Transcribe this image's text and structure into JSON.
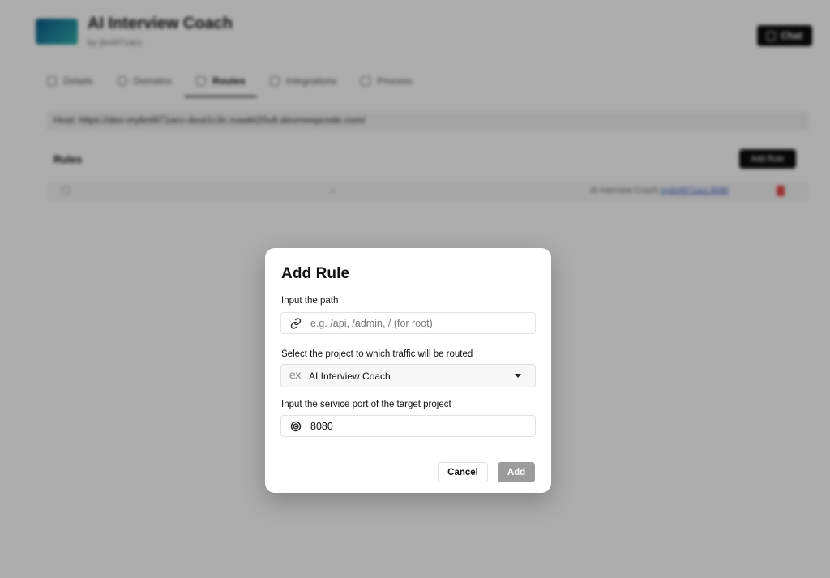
{
  "background": {
    "app_title": "AI Interview Coach",
    "app_subtitle": "by jbnt971acc",
    "chat_button": "Chat",
    "tabs": [
      {
        "label": "Details",
        "icon": "list-icon"
      },
      {
        "label": "Domains",
        "icon": "globe-icon"
      },
      {
        "label": "Routes",
        "icon": "route-icon",
        "active": true
      },
      {
        "label": "Integrations",
        "icon": "grid-icon"
      },
      {
        "label": "Process",
        "icon": "terminal-icon"
      }
    ],
    "host": "Host: https://dev-mybnt971acc-dvut1c3c.ruaakt20ufi.devmeepcode.com/",
    "rules_title": "Rules",
    "add_rule_button": "Add Rule",
    "rule_row": {
      "arrow": "→",
      "destination": "AI Interview Coach",
      "destination_link": "mybnt971acc:8080"
    }
  },
  "modal": {
    "title": "Add Rule",
    "path": {
      "label": "Input the path",
      "placeholder": "e.g. /api, /admin, / (for root)",
      "value": "",
      "icon": "link-icon"
    },
    "project": {
      "label": "Select the project to which traffic will be routed",
      "prefix_icon_text": "ex",
      "value": "AI Interview Coach",
      "icon": "chevron-down-icon"
    },
    "port": {
      "label": "Input the service port of the target project",
      "value": "8080",
      "icon": "target-icon"
    },
    "cancel_label": "Cancel",
    "add_label": "Add"
  },
  "colors": {
    "overlay": "rgba(0,0,0,0.32)",
    "primary_dark": "#0d0d0d",
    "add_disabled": "#9b9b9b",
    "delete_red": "#e24a4a",
    "link_blue": "#2b59c3"
  }
}
